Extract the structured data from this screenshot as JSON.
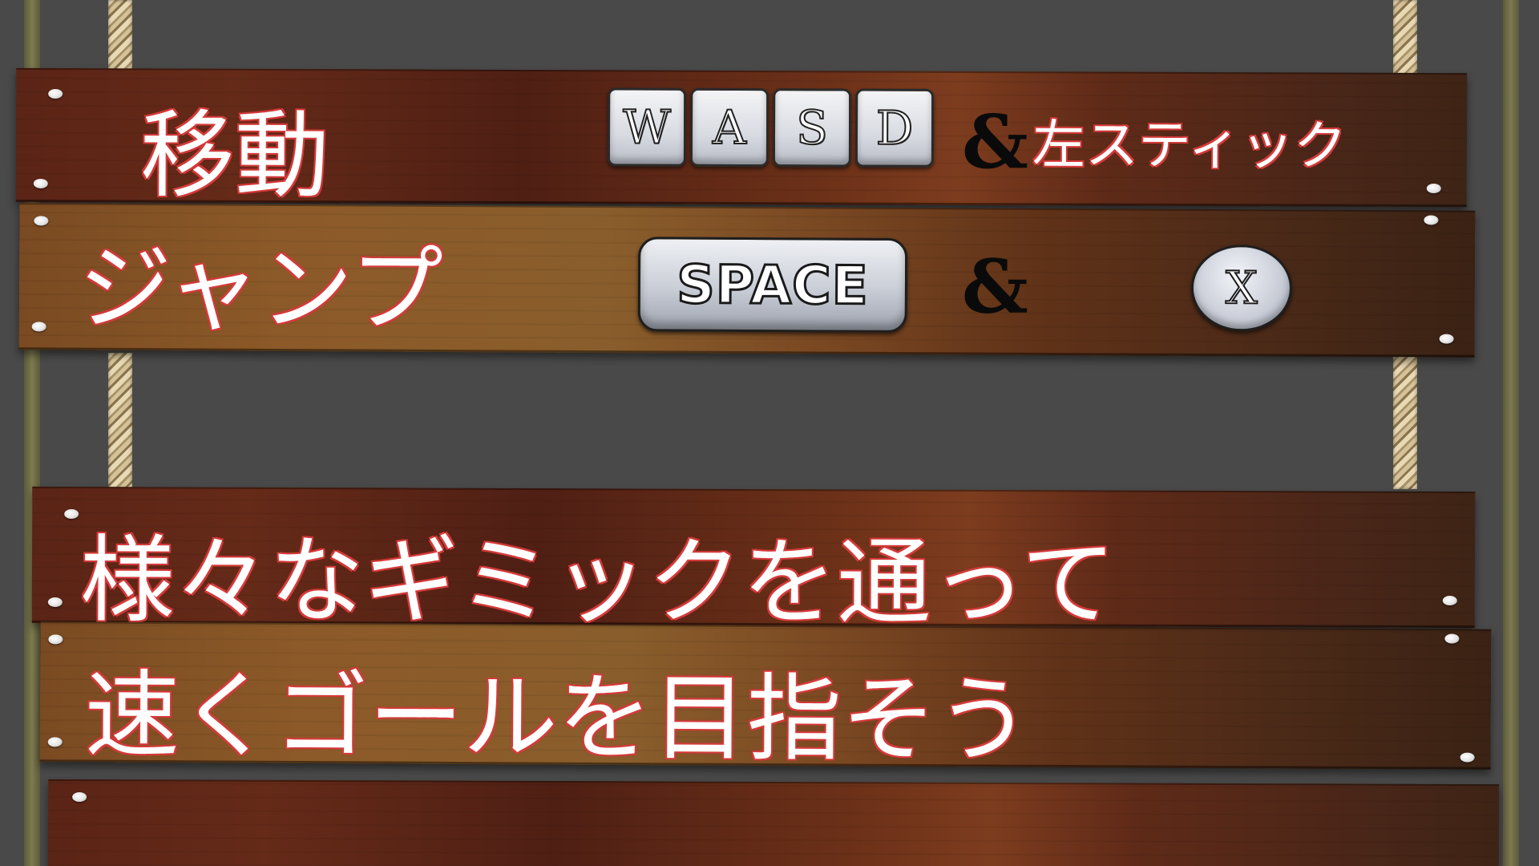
{
  "controls": {
    "move": {
      "label": "移動",
      "keys": [
        "W",
        "A",
        "S",
        "D"
      ],
      "separator": "&",
      "alt": "左スティック"
    },
    "jump": {
      "label": "ジャンプ",
      "key": "SPACE",
      "separator": "&",
      "button": "X"
    }
  },
  "message": {
    "line1": "様々なギミックを通って",
    "line2": "速くゴールを目指そう"
  }
}
